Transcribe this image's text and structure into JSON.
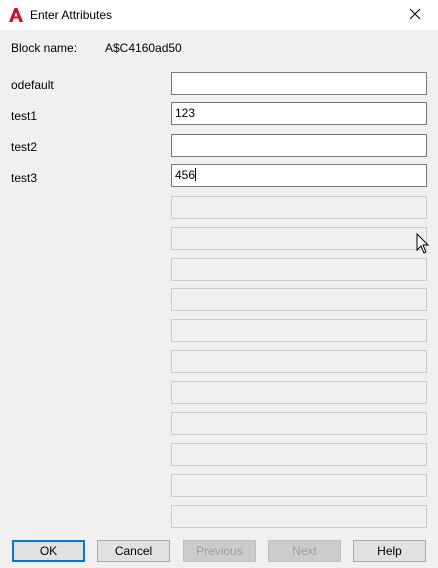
{
  "window": {
    "title": "Enter Attributes",
    "app_icon": "autocad-icon",
    "close_icon": "close-icon"
  },
  "block": {
    "label": "Block name:",
    "value": "A$C4160ad50"
  },
  "attributes": [
    {
      "label": "odefault",
      "value": ""
    },
    {
      "label": "test1",
      "value": "123"
    },
    {
      "label": "test2",
      "value": ""
    },
    {
      "label": "test3",
      "value": "456"
    }
  ],
  "buttons": {
    "ok": "OK",
    "cancel": "Cancel",
    "previous": "Previous",
    "next": "Next",
    "help": "Help"
  }
}
